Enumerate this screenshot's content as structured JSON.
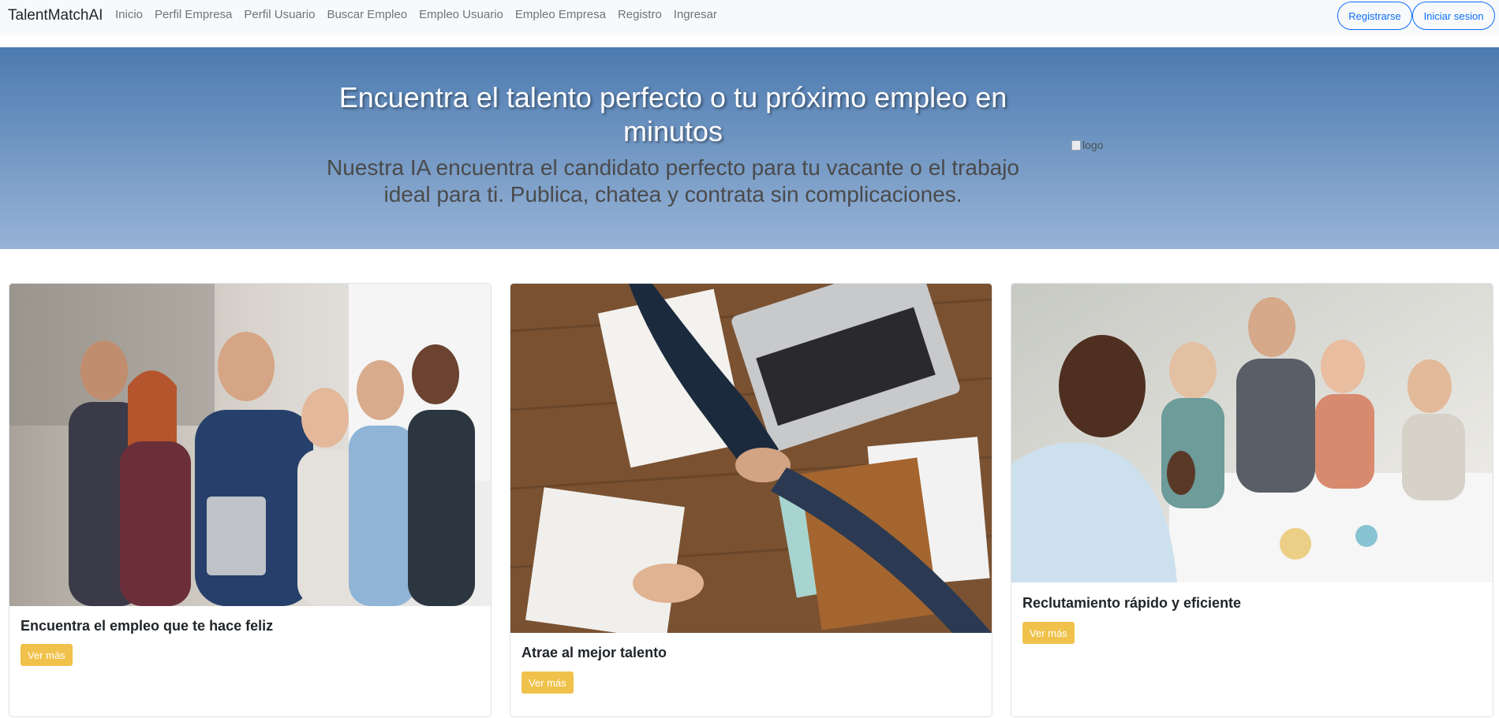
{
  "navbar": {
    "brand": "TalentMatchAI",
    "links": [
      "Inicio",
      "Perfil Empresa",
      "Perfil Usuario",
      "Buscar Empleo",
      "Empleo Usuario",
      "Empleo Empresa",
      "Registro",
      "Ingresar"
    ],
    "register_label": "Registrarse",
    "login_label": "Iniciar sesion"
  },
  "hero": {
    "title": "Encuentra el talento perfecto o tu próximo empleo en minutos",
    "subtitle": "Nuestra IA encuentra el candidato perfecto para tu vacante o el trabajo ideal para ti. Publica, chatea y contrata sin complicaciones.",
    "logo_alt": "logo"
  },
  "cards": [
    {
      "title": "Encuentra el empleo que te hace feliz",
      "button": "Ver más"
    },
    {
      "title": "Atrae al mejor talento",
      "button": "Ver más"
    },
    {
      "title": "Reclutamiento rápido y eficiente",
      "button": "Ver más"
    }
  ],
  "colors": {
    "primary": "#0d6efd",
    "navbar_bg": "#f8f9fa",
    "hero_top": "#4c7bb0",
    "hero_bottom": "#97b3d6",
    "button_yellow": "#f0c24b"
  }
}
